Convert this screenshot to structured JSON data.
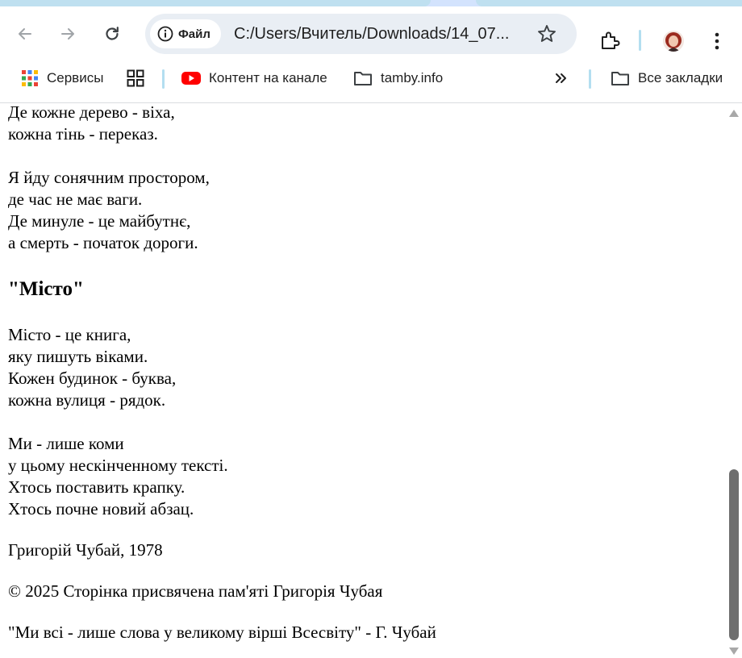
{
  "toolbar": {
    "chip_label": "Файл",
    "url": "C:/Users/Вчитель/Downloads/14_07...",
    "icons": [
      "back-icon",
      "forward-icon",
      "reload-icon",
      "info-icon",
      "star-icon",
      "extensions-icon",
      "menu-icon"
    ]
  },
  "bookmarks": {
    "items": [
      {
        "label": "Сервисы",
        "icon": "apps-grid-icon"
      },
      {
        "label": "",
        "icon": "tab-groups-icon"
      },
      {
        "label": "Контент на канале",
        "icon": "youtube-icon"
      },
      {
        "label": "tamby.info",
        "icon": "folder-icon"
      },
      {
        "label": "Все закладки",
        "icon": "folder-icon"
      }
    ]
  },
  "content": {
    "lines_top": [
      "Де кожне дерево - віха,",
      "кожна тінь - переказ.",
      "Я йду сонячним простором,",
      "де час не має ваги.",
      "Де минуле - це майбутнє,",
      "а смерть - початок дороги."
    ],
    "heading": "\"Місто\"",
    "stanza1": [
      "Місто - це книга,",
      "яку пишуть віками.",
      "Кожен будинок - буква,",
      "кожна вулиця - рядок."
    ],
    "stanza2": [
      "Ми - лише коми",
      "у цьому нескінченному тексті.",
      "Хтось поставить крапку.",
      "Хтось почне новий абзац."
    ],
    "author": "Григорій Чубай, 1978",
    "copyright": "© 2025 Сторінка присвячена пам'яті Григорія Чубая",
    "quote": "\"Ми всі - лише слова у великому вірші Всесвіту\" - Г. Чубай"
  },
  "colors": {
    "accent_tab": "#bfe0f0",
    "omnibox_bg": "#e9eef4",
    "youtube_red": "#ff0000",
    "scroll_thumb": "#6e6e6e"
  }
}
